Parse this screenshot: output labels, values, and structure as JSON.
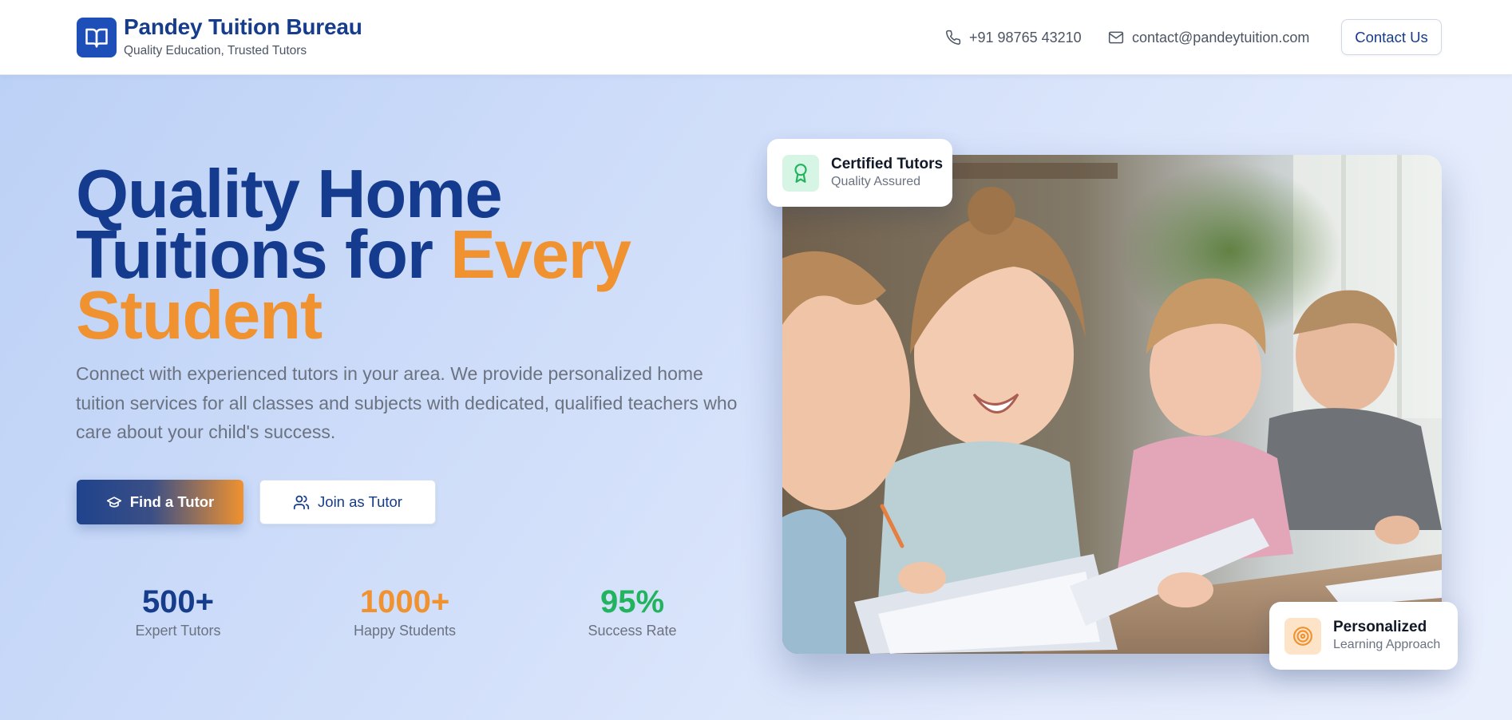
{
  "header": {
    "brand_title": "Pandey Tuition Bureau",
    "brand_subtitle": "Quality Education, Trusted Tutors",
    "phone": "+91 98765 43210",
    "email": "contact@pandeytuition.com",
    "contact_button": "Contact Us"
  },
  "hero": {
    "headline_line1": "Quality Home",
    "headline_line2_a": "Tuitions for ",
    "headline_line2_b": "Every",
    "headline_line3": "Student",
    "lead": "Connect with experienced tutors in your area. We provide personalized home tuition services for all classes and subjects with dedicated, qualified teachers who care about your child's success.",
    "find_button": "Find a Tutor",
    "join_button": "Join as Tutor"
  },
  "stats": [
    {
      "value": "500+",
      "label": "Expert Tutors",
      "color": "#163c8c"
    },
    {
      "value": "1000+",
      "label": "Happy Students",
      "color": "#f0922f"
    },
    {
      "value": "95%",
      "label": "Success Rate",
      "color": "#22b35f"
    }
  ],
  "badges": {
    "certified": {
      "title": "Certified Tutors",
      "subtitle": "Quality Assured",
      "icon": "award-icon"
    },
    "personalized": {
      "title": "Personalized",
      "subtitle": "Learning Approach",
      "icon": "target-icon"
    }
  },
  "colors": {
    "primary": "#163c8c",
    "accent": "#f0922f",
    "success": "#22b35f"
  }
}
